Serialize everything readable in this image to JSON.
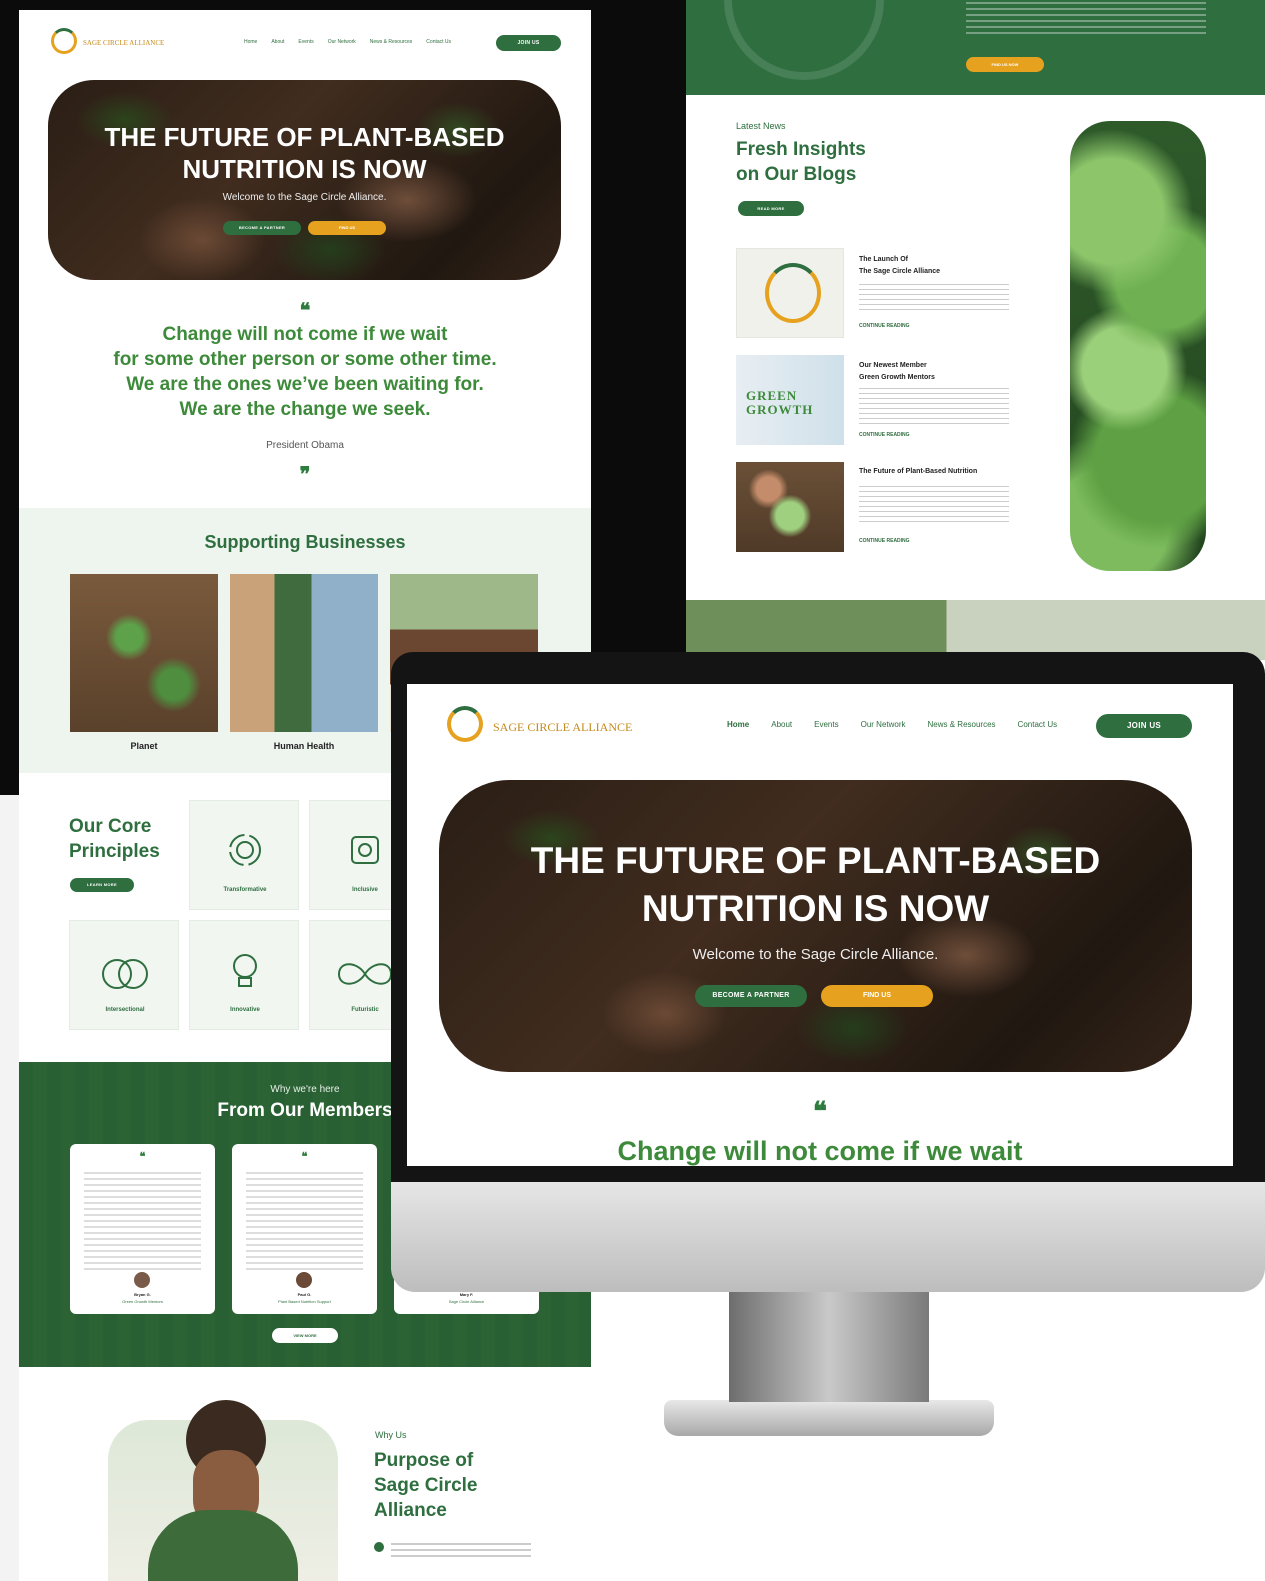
{
  "brand": {
    "name": "SAGE CIRCLE ALLIANCE"
  },
  "nav": {
    "items": [
      "Home",
      "About",
      "Events",
      "Our Network",
      "News & Resources",
      "Contact Us"
    ],
    "join": "JOIN US"
  },
  "hero": {
    "title_line1": "THE FUTURE OF PLANT-BASED",
    "title_line2": "NUTRITION IS NOW",
    "subtitle": "Welcome to the Sage Circle Alliance.",
    "btn_partner": "BECOME A PARTNER",
    "btn_find": "FIND US"
  },
  "quote": {
    "mark_open": "❝",
    "line1": "Change will not come if we wait",
    "line2": "for some other person or some other time.",
    "line3": "We are the ones we’ve been waiting for.",
    "line4": "We are the change we seek.",
    "author": "President Obama",
    "mark_close": "❞"
  },
  "supporting": {
    "title": "Supporting Businesses",
    "items": [
      "Planet",
      "Human Health"
    ]
  },
  "principles": {
    "title_line1": "Our Core",
    "title_line2": "Principles",
    "btn": "LEARN MORE",
    "items": [
      "Transformative",
      "Inclusive",
      "Intersectional",
      "Innovative",
      "Futuristic"
    ]
  },
  "members": {
    "eyebrow": "Why we're here",
    "title": "From Our Members",
    "cards": [
      {
        "name": "Bryan G.",
        "role": "Green Growth Mentors"
      },
      {
        "name": "Paul G.",
        "role": "Plant Based Nutrition Support"
      },
      {
        "name": "Mary F.",
        "role": "Sage Circle Alliance"
      }
    ],
    "btn": "VIEW MORE"
  },
  "why": {
    "eyebrow": "Why Us",
    "title_line1": "Purpose of",
    "title_line2": "Sage Circle",
    "title_line3": "Alliance"
  },
  "blog": {
    "eyebrow": "Latest News",
    "title_line1": "Fresh Insights",
    "title_line2": "on Our Blogs",
    "btn": "READ MORE",
    "top_btn": "FIND US NOW",
    "posts": [
      {
        "title1": "The Launch Of",
        "title2": "The Sage Circle Alliance",
        "link": "CONTINUE READING"
      },
      {
        "title1": "Our Newest Member",
        "title2": "Green Growth Mentors",
        "link": "CONTINUE READING",
        "logo": "GREEN GROWTH"
      },
      {
        "title1": "The Future of Plant-Based Nutrition",
        "title2": "",
        "link": "CONTINUE READING"
      }
    ]
  },
  "colors": {
    "brand_green": "#2e6e3f",
    "accent_orange": "#e6a21e",
    "light_green_bg": "#eef4ee"
  }
}
